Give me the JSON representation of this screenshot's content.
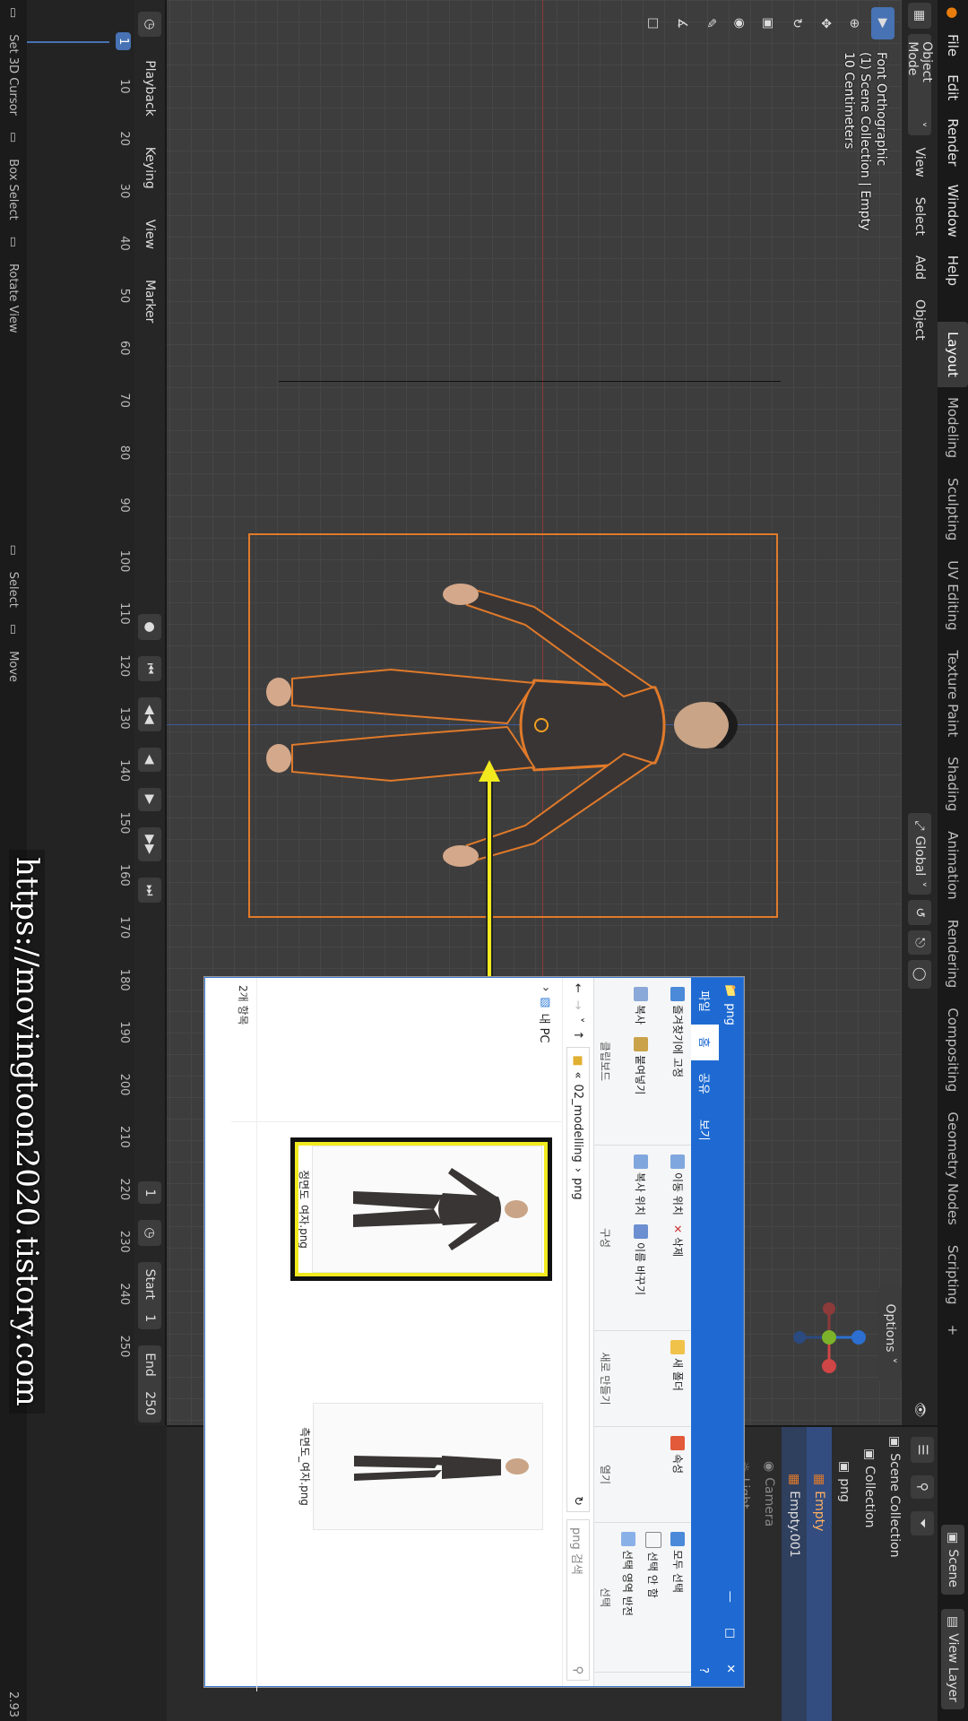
{
  "app": {
    "menu": [
      "File",
      "Edit",
      "Render",
      "Window",
      "Help"
    ],
    "workspaces": [
      "Layout",
      "Modeling",
      "Sculpting",
      "UV Editing",
      "Texture Paint",
      "Shading",
      "Animation",
      "Rendering",
      "Compositing",
      "Geometry Nodes",
      "Scripting"
    ],
    "active_workspace": "Layout",
    "scene_label": "Scene",
    "view_layer_label": "View Layer"
  },
  "header": {
    "mode": "Object Mode",
    "menus": [
      "View",
      "Select",
      "Add",
      "Object"
    ],
    "transform_orientation": "Global",
    "options_label": "Options"
  },
  "viewport": {
    "hud_lines": [
      "Font Orthographic",
      "(1) Scene Collection | Empty",
      "10 Centimeters"
    ]
  },
  "outliner": {
    "root": "Scene Collection",
    "items": [
      "Collection",
      "png",
      "Empty",
      "Empty.001",
      "Camera",
      "Light"
    ],
    "selected": "Empty"
  },
  "timeline": {
    "menus": [
      "Playback",
      "Keying",
      "View",
      "Marker"
    ],
    "current_frame": "1",
    "ticks": [
      "10",
      "20",
      "30",
      "40",
      "50",
      "60",
      "70",
      "80",
      "90",
      "100",
      "110",
      "120",
      "130",
      "140",
      "150",
      "160",
      "170",
      "180",
      "190",
      "200",
      "210",
      "220",
      "230",
      "240",
      "250"
    ],
    "start_label": "Start",
    "start": "1",
    "end_label": "End",
    "end": "250",
    "frame_field": "1"
  },
  "statusbar": {
    "items": [
      "Set 3D Cursor",
      "Box Select",
      "Rotate View",
      "Select",
      "Move"
    ],
    "version": "2.93"
  },
  "watermark": "https://movingtoon2020.tistory.com",
  "explorer": {
    "title": "png",
    "tabs": [
      "파일",
      "홈",
      "공유",
      "보기"
    ],
    "ribbon": {
      "clipboard": {
        "pin": "즐겨찾기에 고정",
        "copy": "복사",
        "paste": "붙여넣기",
        "label": "클립보드"
      },
      "organize": {
        "move": "이동 위치",
        "copy_to": "복사 위치",
        "delete": "삭제",
        "rename": "이름 바꾸기",
        "label": "구성"
      },
      "new": {
        "folder": "새 폴더",
        "label": "새로 만들기"
      },
      "open": {
        "props": "속성",
        "label": "열기"
      },
      "select": {
        "all": "모두 선택",
        "none": "선택 안 함",
        "invert": "선택 영역 반전",
        "label": "선택"
      }
    },
    "breadcrumb": [
      "«",
      "02_modelling",
      "png"
    ],
    "search_placeholder": "png 검색",
    "nav": [
      "내 PC"
    ],
    "files": [
      "정면도_여자.png",
      "측면도_여자.png"
    ],
    "status": "2개 항목"
  },
  "colors": {
    "accent": "#4772b3",
    "selection_orange": "#e07a2a",
    "highlight_yellow": "#f2ea1f",
    "explorer_blue": "#1e6ad2"
  }
}
